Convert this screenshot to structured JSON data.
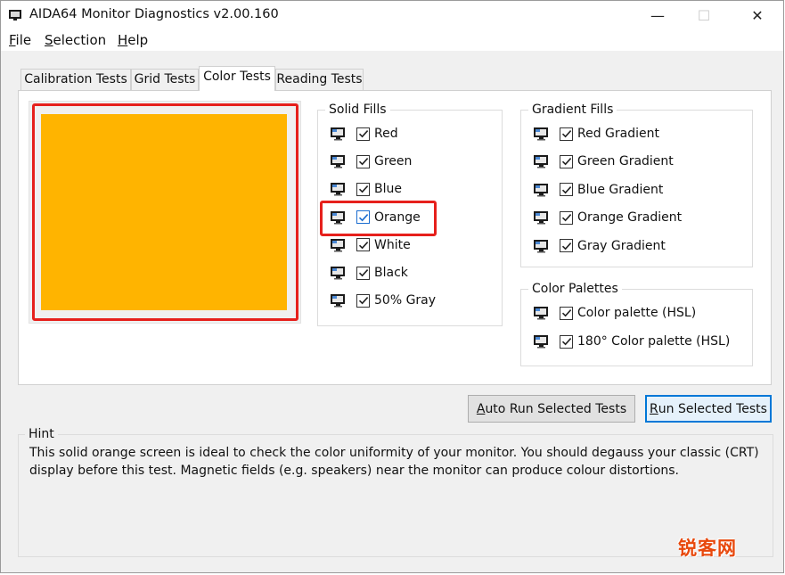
{
  "window": {
    "title": "AIDA64 Monitor Diagnostics v2.00.160",
    "controls": {
      "minimize": "—",
      "maximize": "☐",
      "close": "✕"
    }
  },
  "menu": [
    {
      "label": "File",
      "accel": "F",
      "rest": "ile"
    },
    {
      "label": "Selection",
      "accel": "S",
      "rest": "election"
    },
    {
      "label": "Help",
      "accel": "H",
      "rest": "elp"
    }
  ],
  "tabs": [
    {
      "label": "Calibration Tests",
      "active": false
    },
    {
      "label": "Grid Tests",
      "active": false
    },
    {
      "label": "Color Tests",
      "active": true
    },
    {
      "label": "Reading Tests",
      "active": false
    }
  ],
  "preview": {
    "color": "#ffb400"
  },
  "groups": {
    "solid_fills": {
      "label": "Solid Fills",
      "items": [
        {
          "label": "Red",
          "checked": true
        },
        {
          "label": "Green",
          "checked": true
        },
        {
          "label": "Blue",
          "checked": true
        },
        {
          "label": "Orange",
          "checked": true,
          "selected": true
        },
        {
          "label": "White",
          "checked": true
        },
        {
          "label": "Black",
          "checked": true
        },
        {
          "label": "50% Gray",
          "checked": true
        }
      ]
    },
    "gradient_fills": {
      "label": "Gradient Fills",
      "items": [
        {
          "label": "Red Gradient",
          "checked": true
        },
        {
          "label": "Green Gradient",
          "checked": true
        },
        {
          "label": "Blue Gradient",
          "checked": true
        },
        {
          "label": "Orange Gradient",
          "checked": true
        },
        {
          "label": "Gray Gradient",
          "checked": true
        }
      ]
    },
    "color_palettes": {
      "label": "Color Palettes",
      "items": [
        {
          "label": "Color palette (HSL)",
          "checked": true
        },
        {
          "label": "180° Color palette (HSL)",
          "checked": true
        }
      ]
    }
  },
  "buttons": {
    "auto_run": {
      "accel": "A",
      "rest": "uto Run Selected Tests"
    },
    "run": {
      "accel": "R",
      "rest": "un Selected Tests"
    }
  },
  "hint": {
    "label": "Hint",
    "text": "This solid orange screen is ideal to check the color uniformity of your monitor. You should degauss your classic (CRT) display before this test. Magnetic fields (e.g. speakers) near the monitor can produce colour distortions."
  },
  "watermark": {
    "text": "锐客网"
  },
  "colors": {
    "accent": "#0078d7",
    "highlight": "#e6201c",
    "orange": "#ffb400"
  }
}
